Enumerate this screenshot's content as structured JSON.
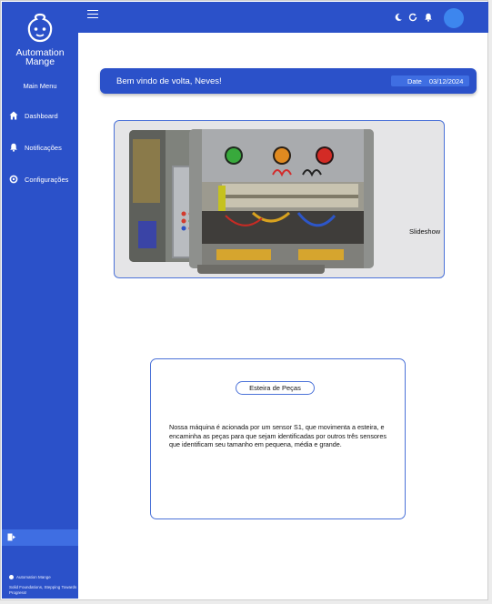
{
  "sidebar": {
    "brand_line1": "Automation",
    "brand_line2": "Mange",
    "main_menu": "Main Menu",
    "items": [
      {
        "label": "Dashboard",
        "icon": "home-icon"
      },
      {
        "label": "Notificações",
        "icon": "bell-icon"
      },
      {
        "label": "Configurações",
        "icon": "gear-icon"
      }
    ],
    "logout_icon": "logout-icon",
    "footer_brand": "Automation Mange",
    "footer_tagline": "Solid Foundations, Stepping Towards Progress!"
  },
  "topbar": {
    "icons": [
      "menu-icon",
      "moon-icon",
      "refresh-icon",
      "bell-icon",
      "avatar"
    ]
  },
  "welcome": {
    "message": "Bem vindo de volta, Neves!",
    "date_label": "Date",
    "date_value": "03/12/2024"
  },
  "slideshow": {
    "label": "Slideshow"
  },
  "info_card": {
    "title": "Esteira de Peças",
    "text": "Nossa máquina é acionada por um sensor S1, que movimenta a esteira, e encaminha as peças para que sejam identificadas por outros três sensores que identificam seu tamanho em pequena, média e grande."
  },
  "colors": {
    "primary": "#2b51c9",
    "accent": "#3f6ee2",
    "avatar": "#3d86ee",
    "card_border": "#4b72d8"
  }
}
